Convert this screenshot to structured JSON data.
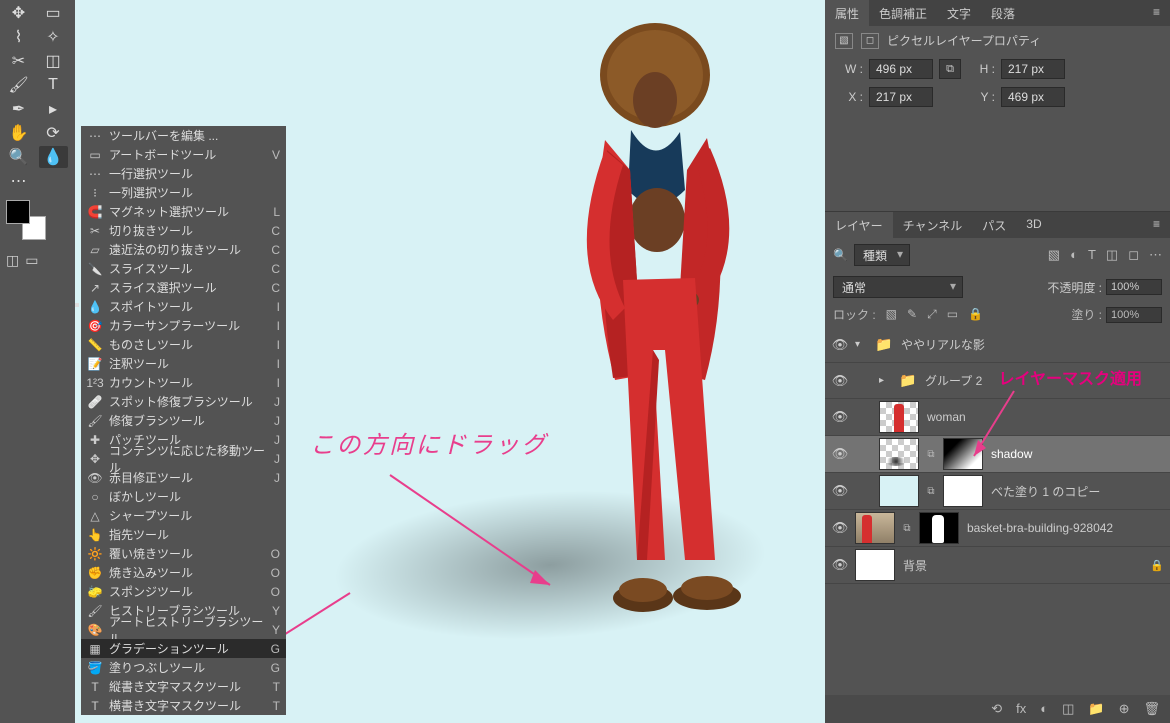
{
  "flyout": {
    "header": "ツールバーを編集 ...",
    "items": [
      {
        "icon": "▭",
        "label": "アートボードツール",
        "shortcut": "V"
      },
      {
        "icon": "⋯",
        "label": "一行選択ツール",
        "shortcut": ""
      },
      {
        "icon": "⁝",
        "label": "一列選択ツール",
        "shortcut": ""
      },
      {
        "icon": "🧲",
        "label": "マグネット選択ツール",
        "shortcut": "L"
      },
      {
        "icon": "✂",
        "label": "切り抜きツール",
        "shortcut": "C"
      },
      {
        "icon": "▱",
        "label": "遠近法の切り抜きツール",
        "shortcut": "C"
      },
      {
        "icon": "🔪",
        "label": "スライスツール",
        "shortcut": "C"
      },
      {
        "icon": "↗",
        "label": "スライス選択ツール",
        "shortcut": "C"
      },
      {
        "icon": "💧",
        "label": "スポイトツール",
        "shortcut": "I",
        "dot": true
      },
      {
        "icon": "🎯",
        "label": "カラーサンプラーツール",
        "shortcut": "I"
      },
      {
        "icon": "📏",
        "label": "ものさしツール",
        "shortcut": "I"
      },
      {
        "icon": "📝",
        "label": "注釈ツール",
        "shortcut": "I"
      },
      {
        "icon": "1²3",
        "label": "カウントツール",
        "shortcut": "I"
      },
      {
        "icon": "🩹",
        "label": "スポット修復ブラシツール",
        "shortcut": "J"
      },
      {
        "icon": "🖌",
        "label": "修復ブラシツール",
        "shortcut": "J"
      },
      {
        "icon": "✚",
        "label": "パッチツール",
        "shortcut": "J"
      },
      {
        "icon": "✥",
        "label": "コンテンツに応じた移動ツール",
        "shortcut": "J"
      },
      {
        "icon": "👁",
        "label": "赤目修正ツール",
        "shortcut": "J"
      },
      {
        "icon": "○",
        "label": "ぼかしツール",
        "shortcut": ""
      },
      {
        "icon": "△",
        "label": "シャープツール",
        "shortcut": ""
      },
      {
        "icon": "👆",
        "label": "指先ツール",
        "shortcut": ""
      },
      {
        "icon": "🔆",
        "label": "覆い焼きツール",
        "shortcut": "O"
      },
      {
        "icon": "✊",
        "label": "焼き込みツール",
        "shortcut": "O"
      },
      {
        "icon": "🧽",
        "label": "スポンジツール",
        "shortcut": "O"
      },
      {
        "icon": "🖌",
        "label": "ヒストリーブラシツール",
        "shortcut": "Y"
      },
      {
        "icon": "🎨",
        "label": "アートヒストリーブラシツール",
        "shortcut": "Y"
      },
      {
        "icon": "▦",
        "label": "グラデーションツール",
        "shortcut": "G",
        "sel": true
      },
      {
        "icon": "🪣",
        "label": "塗りつぶしツール",
        "shortcut": "G"
      },
      {
        "icon": "T",
        "label": "縦書き文字マスクツール",
        "shortcut": "T"
      },
      {
        "icon": "T",
        "label": "横書き文字マスクツール",
        "shortcut": "T"
      }
    ]
  },
  "annotations": {
    "drag": "この方向にドラッグ",
    "mask": "レイヤーマスク適用"
  },
  "props": {
    "tabs": [
      "属性",
      "色調補正",
      "文字",
      "段落"
    ],
    "title": "ピクセルレイヤープロパティ",
    "W_label": "W :",
    "W": "496 px",
    "H_label": "H :",
    "H": "217 px",
    "X_label": "X :",
    "X": "217 px",
    "Y_label": "Y :",
    "Y": "469 px"
  },
  "layers": {
    "tabs": [
      "レイヤー",
      "チャンネル",
      "パス",
      "3D"
    ],
    "search_icon": "🔍",
    "kind": "種類",
    "kind_icons": [
      "▧",
      "◐",
      "T",
      "◫",
      "◻",
      "⋯"
    ],
    "blend": "通常",
    "opacity_label": "不透明度 :",
    "opacity": "100%",
    "lock_label": "ロック :",
    "fill_label": "塗り :",
    "fill": "100%",
    "lock_icons": [
      "▧",
      "✎",
      "⤢",
      "▭",
      "🔒"
    ],
    "items": [
      {
        "type": "group",
        "label": "ややリアルな影",
        "open": true,
        "level": 0
      },
      {
        "type": "group",
        "label": "グループ 2",
        "open": false,
        "level": 1
      },
      {
        "type": "layer",
        "label": "woman",
        "level": 1,
        "thumb": "woman"
      },
      {
        "type": "layer",
        "label": "shadow",
        "level": 1,
        "thumb": "shadow",
        "mask": true,
        "sel": true
      },
      {
        "type": "layer",
        "label": "べた塗り 1 のコピー",
        "level": 1,
        "thumb": "fill",
        "mask_white": true
      },
      {
        "type": "layer",
        "label": "basket-bra-building-928042",
        "level": 0,
        "thumb": "photo",
        "mask_sil": true
      },
      {
        "type": "layer",
        "label": "背景",
        "level": 0,
        "thumb": "white",
        "locked": true
      }
    ],
    "foot_icons": [
      "⟲",
      "fx",
      "◐",
      "◫",
      "📁",
      "⊕",
      "🗑"
    ]
  }
}
